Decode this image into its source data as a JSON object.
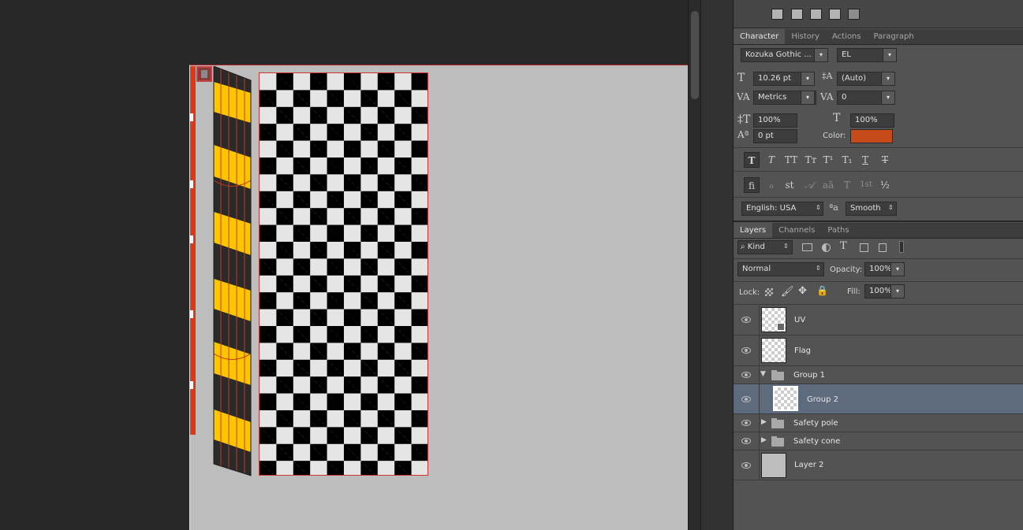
{
  "top_icons": [
    "warp-icon",
    "distort-icon",
    "perspective-icon",
    "cancel-transform-icon",
    "commit-transform-icon"
  ],
  "character_panel": {
    "tabs": [
      "Character",
      "History",
      "Actions",
      "Paragraph"
    ],
    "active_tab": "Character",
    "font_family": "Kozuka Gothic ...",
    "font_style": "EL",
    "font_size": "10.26 pt",
    "leading": "(Auto)",
    "kerning": "Metrics",
    "tracking": "0",
    "vertical_scale": "100%",
    "horizontal_scale": "100%",
    "baseline_shift": "0 pt",
    "color_label": "Color:",
    "color_value": "#c44a1a",
    "style_buttons": [
      "T",
      "T",
      "TT",
      "Tт",
      "T¹",
      "T₁",
      "T",
      "T"
    ],
    "opentype_buttons": [
      "fi",
      "ℴ",
      "st",
      "𝒜",
      "aā",
      "T",
      "1st",
      "½"
    ],
    "language": "English: USA",
    "antialias": "Smooth"
  },
  "layers_panel": {
    "tabs": [
      "Layers",
      "Channels",
      "Paths"
    ],
    "active_tab": "Layers",
    "filter_kind": "Kind",
    "blend_mode": "Normal",
    "opacity_label": "Opacity:",
    "opacity": "100%",
    "lock_label": "Lock:",
    "fill_label": "Fill:",
    "fill": "100%",
    "layers": [
      {
        "name": "UV",
        "type": "smart",
        "visible": true
      },
      {
        "name": "Flag",
        "type": "layer",
        "visible": true
      },
      {
        "name": "Group 1",
        "type": "group-open",
        "visible": true
      },
      {
        "name": "Group 2",
        "type": "layer-child",
        "visible": true,
        "selected": true
      },
      {
        "name": "Safety pole",
        "type": "group-closed",
        "visible": true
      },
      {
        "name": "Safety cone",
        "type": "group-closed",
        "visible": true
      },
      {
        "name": "Layer 2",
        "type": "fill-gray",
        "visible": true
      }
    ]
  },
  "colors": {
    "accent_red": "#d83a1a",
    "stripe_yellow": "#ffc600",
    "stripe_dark": "#2a2a2a",
    "selected_row": "#5e6a7d"
  }
}
